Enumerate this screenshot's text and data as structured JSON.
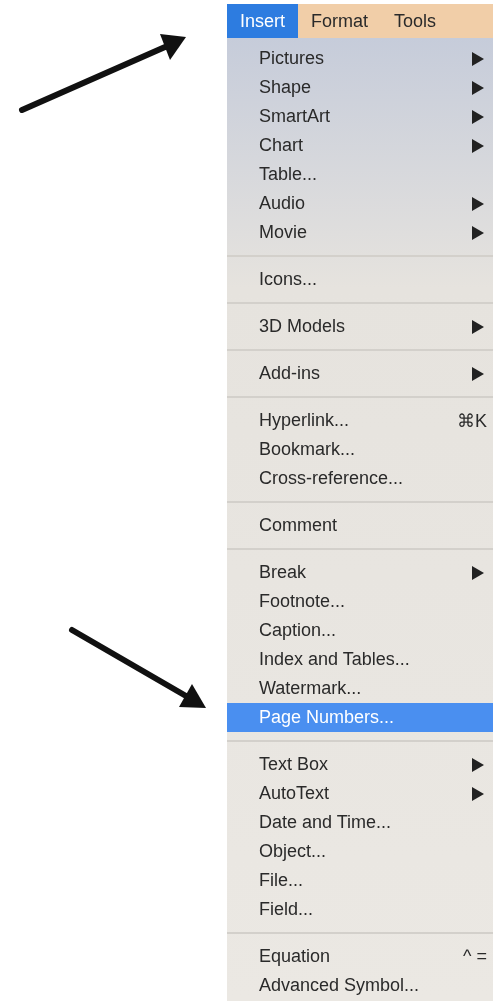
{
  "menu_bar": [
    {
      "label": "Insert",
      "selected": true
    },
    {
      "label": "Format",
      "selected": false
    },
    {
      "label": "Tools",
      "selected": false
    }
  ],
  "menu": {
    "groups": [
      [
        {
          "label": "Pictures",
          "submenu": true,
          "selected": false
        },
        {
          "label": "Shape",
          "submenu": true,
          "selected": false
        },
        {
          "label": "SmartArt",
          "submenu": true,
          "selected": false
        },
        {
          "label": "Chart",
          "submenu": true,
          "selected": false
        },
        {
          "label": "Table...",
          "submenu": false,
          "selected": false
        },
        {
          "label": "Audio",
          "submenu": true,
          "selected": false
        },
        {
          "label": "Movie",
          "submenu": true,
          "selected": false
        }
      ],
      [
        {
          "label": "Icons...",
          "submenu": false,
          "selected": false
        }
      ],
      [
        {
          "label": "3D Models",
          "submenu": true,
          "selected": false
        }
      ],
      [
        {
          "label": "Add-ins",
          "submenu": true,
          "selected": false
        }
      ],
      [
        {
          "label": "Hyperlink...",
          "submenu": false,
          "selected": false,
          "shortcut": "⌘K"
        },
        {
          "label": "Bookmark...",
          "submenu": false,
          "selected": false
        },
        {
          "label": "Cross-reference...",
          "submenu": false,
          "selected": false
        }
      ],
      [
        {
          "label": "Comment",
          "submenu": false,
          "selected": false
        }
      ],
      [
        {
          "label": "Break",
          "submenu": true,
          "selected": false
        },
        {
          "label": "Footnote...",
          "submenu": false,
          "selected": false
        },
        {
          "label": "Caption...",
          "submenu": false,
          "selected": false
        },
        {
          "label": "Index and Tables...",
          "submenu": false,
          "selected": false
        },
        {
          "label": "Watermark...",
          "submenu": false,
          "selected": false
        },
        {
          "label": "Page Numbers...",
          "submenu": false,
          "selected": true
        }
      ],
      [
        {
          "label": "Text Box",
          "submenu": true,
          "selected": false
        },
        {
          "label": "AutoText",
          "submenu": true,
          "selected": false
        },
        {
          "label": "Date and Time...",
          "submenu": false,
          "selected": false
        },
        {
          "label": "Object...",
          "submenu": false,
          "selected": false
        },
        {
          "label": "File...",
          "submenu": false,
          "selected": false
        },
        {
          "label": "Field...",
          "submenu": false,
          "selected": false
        }
      ],
      [
        {
          "label": "Equation",
          "submenu": false,
          "selected": false,
          "shortcut": "^ ="
        },
        {
          "label": "Advanced Symbol...",
          "submenu": false,
          "selected": false
        }
      ]
    ]
  }
}
